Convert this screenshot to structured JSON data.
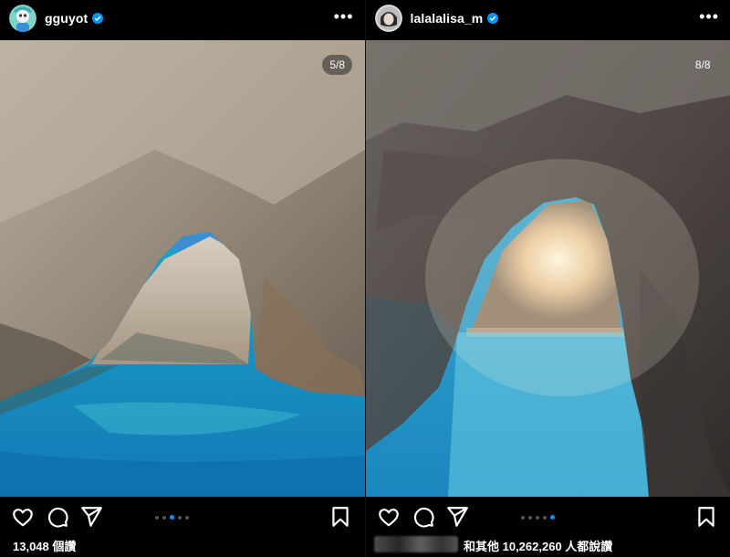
{
  "posts": [
    {
      "username": "gguyot",
      "counter": "5/8",
      "likes": "13,048 個讚",
      "carousel": {
        "total_dots": 5,
        "active_dot": 2
      }
    },
    {
      "username": "lalalalisa_m",
      "counter": "8/8",
      "likes": "和其他 10,262,260 人都說讚",
      "carousel": {
        "total_dots": 5,
        "active_dot": 4
      }
    }
  ],
  "icons": {
    "more": "more-horizontal-icon",
    "like": "heart-icon",
    "comment": "comment-icon",
    "share": "send-icon",
    "save": "bookmark-icon",
    "verified": "verified-badge-icon"
  },
  "colors": {
    "background": "#000000",
    "accent": "#0095f6",
    "verified": "#0095f6"
  }
}
